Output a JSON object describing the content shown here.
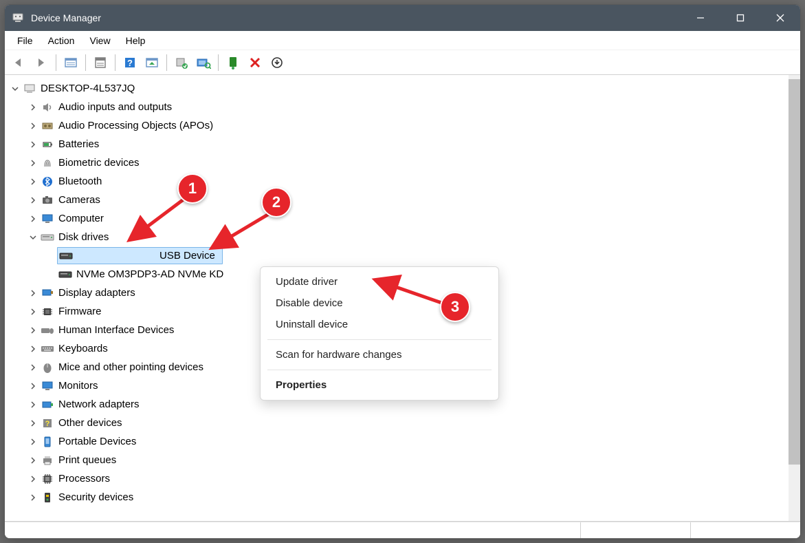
{
  "window": {
    "title": "Device Manager"
  },
  "menu": {
    "file": "File",
    "action": "Action",
    "view": "View",
    "help": "Help"
  },
  "tree": {
    "root": "DESKTOP-4L537JQ",
    "categories": [
      {
        "label": "Audio inputs and outputs",
        "expanded": false
      },
      {
        "label": "Audio Processing Objects (APOs)",
        "expanded": false
      },
      {
        "label": "Batteries",
        "expanded": false
      },
      {
        "label": "Biometric devices",
        "expanded": false
      },
      {
        "label": "Bluetooth",
        "expanded": false
      },
      {
        "label": "Cameras",
        "expanded": false
      },
      {
        "label": "Computer",
        "expanded": false
      },
      {
        "label": "Disk drives",
        "expanded": true,
        "children": [
          {
            "label": "USB Device",
            "selected": true
          },
          {
            "label": "NVMe OM3PDP3-AD NVMe KD",
            "selected": false
          }
        ]
      },
      {
        "label": "Display adapters",
        "expanded": false
      },
      {
        "label": "Firmware",
        "expanded": false
      },
      {
        "label": "Human Interface Devices",
        "expanded": false
      },
      {
        "label": "Keyboards",
        "expanded": false
      },
      {
        "label": "Mice and other pointing devices",
        "expanded": false
      },
      {
        "label": "Monitors",
        "expanded": false
      },
      {
        "label": "Network adapters",
        "expanded": false
      },
      {
        "label": "Other devices",
        "expanded": false
      },
      {
        "label": "Portable Devices",
        "expanded": false
      },
      {
        "label": "Print queues",
        "expanded": false
      },
      {
        "label": "Processors",
        "expanded": false
      },
      {
        "label": "Security devices",
        "expanded": false
      }
    ]
  },
  "context_menu": {
    "update": "Update driver",
    "disable": "Disable device",
    "uninstall": "Uninstall device",
    "scan": "Scan for hardware changes",
    "properties": "Properties"
  },
  "annotations": {
    "b1": "1",
    "b2": "2",
    "b3": "3"
  }
}
